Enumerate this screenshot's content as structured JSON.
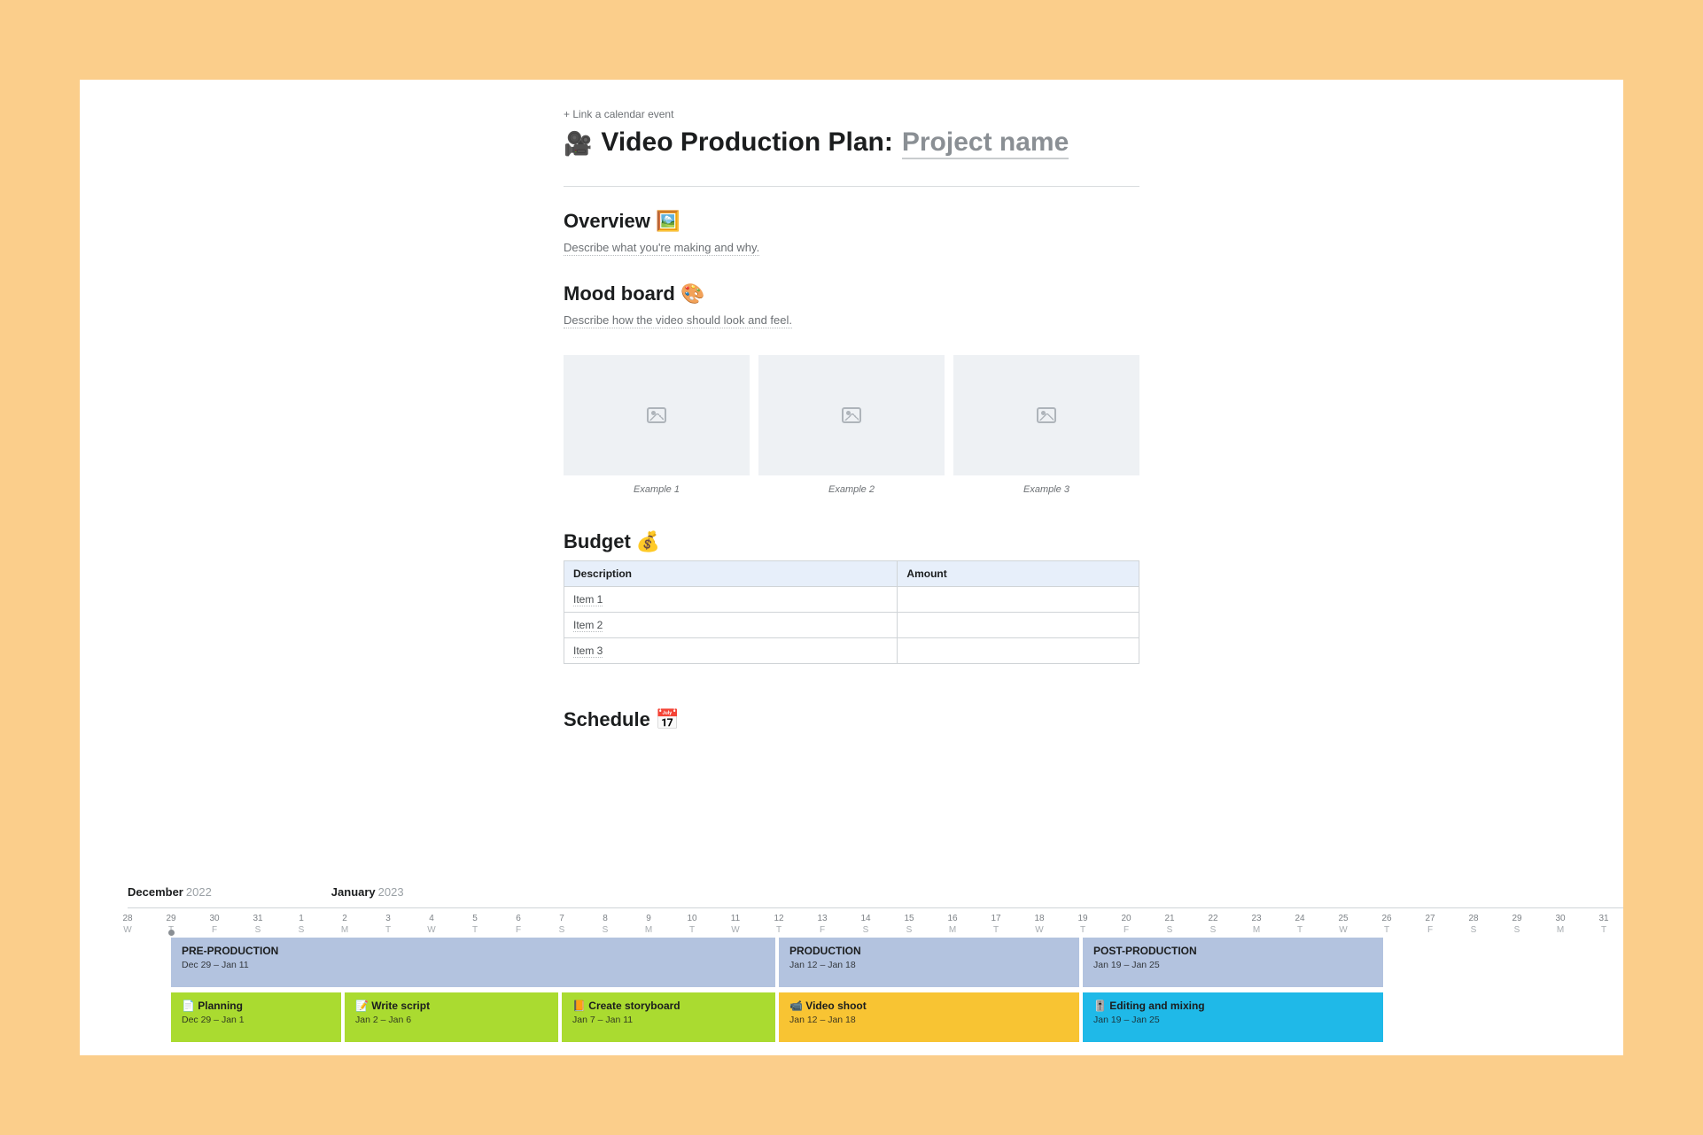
{
  "link_calendar": "+ Link a calendar event",
  "title": {
    "emoji": "🎥",
    "text": "Video Production Plan:",
    "placeholder": "Project name"
  },
  "sections": {
    "overview": {
      "heading": "Overview 🖼️",
      "prompt": "Describe what you're making and why."
    },
    "mood": {
      "heading": "Mood board 🎨",
      "prompt": "Describe how the video should look and feel.",
      "examples": [
        "Example 1",
        "Example 2",
        "Example 3"
      ]
    },
    "budget": {
      "heading": "Budget 💰",
      "columns": [
        "Description",
        "Amount"
      ],
      "rows": [
        "Item 1",
        "Item 2",
        "Item 3"
      ]
    },
    "schedule": {
      "heading": "Schedule 📅"
    }
  },
  "timeline": {
    "months": [
      {
        "name": "December",
        "year": "2022"
      },
      {
        "name": "January",
        "year": "2023"
      }
    ],
    "days": [
      {
        "num": "28",
        "dow": "W"
      },
      {
        "num": "29",
        "dow": "T"
      },
      {
        "num": "30",
        "dow": "F"
      },
      {
        "num": "31",
        "dow": "S"
      },
      {
        "num": "1",
        "dow": "S"
      },
      {
        "num": "2",
        "dow": "M"
      },
      {
        "num": "3",
        "dow": "T"
      },
      {
        "num": "4",
        "dow": "W"
      },
      {
        "num": "5",
        "dow": "T"
      },
      {
        "num": "6",
        "dow": "F"
      },
      {
        "num": "7",
        "dow": "S"
      },
      {
        "num": "8",
        "dow": "S"
      },
      {
        "num": "9",
        "dow": "M"
      },
      {
        "num": "10",
        "dow": "T"
      },
      {
        "num": "11",
        "dow": "W"
      },
      {
        "num": "12",
        "dow": "T"
      },
      {
        "num": "13",
        "dow": "F"
      },
      {
        "num": "14",
        "dow": "S"
      },
      {
        "num": "15",
        "dow": "S"
      },
      {
        "num": "16",
        "dow": "M"
      },
      {
        "num": "17",
        "dow": "T"
      },
      {
        "num": "18",
        "dow": "W"
      },
      {
        "num": "19",
        "dow": "T"
      },
      {
        "num": "20",
        "dow": "F"
      },
      {
        "num": "21",
        "dow": "S"
      },
      {
        "num": "22",
        "dow": "S"
      },
      {
        "num": "23",
        "dow": "M"
      },
      {
        "num": "24",
        "dow": "T"
      },
      {
        "num": "25",
        "dow": "W"
      },
      {
        "num": "26",
        "dow": "T"
      },
      {
        "num": "27",
        "dow": "F"
      },
      {
        "num": "28",
        "dow": "S"
      },
      {
        "num": "29",
        "dow": "S"
      },
      {
        "num": "30",
        "dow": "M"
      },
      {
        "num": "31",
        "dow": "T"
      }
    ],
    "today_index": 1,
    "phases": [
      {
        "title": "PRE-PRODUCTION",
        "dates": "Dec 29 – Jan 11",
        "start": 1,
        "span": 14
      },
      {
        "title": "PRODUCTION",
        "dates": "Jan 12 – Jan 18",
        "start": 15,
        "span": 7
      },
      {
        "title": "POST-PRODUCTION",
        "dates": "Jan 19 – Jan 25",
        "start": 22,
        "span": 7
      }
    ],
    "tasks": [
      {
        "emoji": "📄",
        "title": "Planning",
        "dates": "Dec 29 – Jan 1",
        "start": 1,
        "span": 4,
        "color": "green"
      },
      {
        "emoji": "📝",
        "title": "Write script",
        "dates": "Jan 2 – Jan 6",
        "start": 5,
        "span": 5,
        "color": "green"
      },
      {
        "emoji": "📙",
        "title": "Create storyboard",
        "dates": "Jan 7 – Jan 11",
        "start": 10,
        "span": 5,
        "color": "green"
      },
      {
        "emoji": "📹",
        "title": "Video shoot",
        "dates": "Jan 12 – Jan 18",
        "start": 15,
        "span": 7,
        "color": "yellow"
      },
      {
        "emoji": "🎚️",
        "title": "Editing and mixing",
        "dates": "Jan 19 – Jan 25",
        "start": 22,
        "span": 7,
        "color": "blue"
      }
    ]
  }
}
